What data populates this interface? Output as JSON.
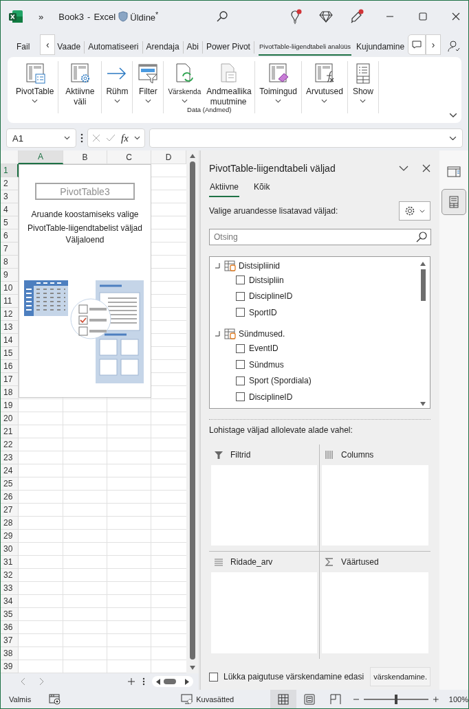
{
  "title_bar": {
    "quick_access": "»",
    "document": "Book3",
    "separator": "-",
    "app": "Excel",
    "sensitivity": "Üldine$^{*}$"
  },
  "ribbon_tabs": [
    {
      "label": "Fail",
      "selected": false
    },
    {
      "label": "Vaade",
      "selected": false
    },
    {
      "label": "Automatiseeri",
      "selected": false
    },
    {
      "label": "Arendaja",
      "selected": false
    },
    {
      "label": "Abi",
      "selected": false
    },
    {
      "label": "Power Pivot",
      "selected": false
    },
    {
      "label": "PivotTable-liigendtabeli analüüs",
      "selected": true
    },
    {
      "label": "Kujundamine",
      "selected": false
    }
  ],
  "ribbon_scroll": {
    "left": "‹",
    "right": "›"
  },
  "ribbon": {
    "groups": [
      {
        "commands": [
          {
            "kind": "pivottable",
            "label": "PivotTable",
            "dropdown": true
          }
        ]
      },
      {
        "commands": [
          {
            "kind": "active_field",
            "label": "Aktiivne väli",
            "dropdown": false
          }
        ]
      },
      {
        "commands": [
          {
            "kind": "group",
            "label": "Rühm",
            "dropdown": true
          }
        ]
      },
      {
        "commands": [
          {
            "kind": "filter",
            "label": "Filter",
            "dropdown": true
          }
        ]
      },
      {
        "label": "Data (Andmed)",
        "commands": [
          {
            "kind": "refresh",
            "label": "Värskenda",
            "dropdown": true
          },
          {
            "kind": "data_source",
            "label": "Andmeallika muutmine",
            "dropdown": false
          }
        ]
      },
      {
        "commands": [
          {
            "kind": "actions",
            "label": "Toimingud",
            "dropdown": true
          }
        ]
      },
      {
        "commands": [
          {
            "kind": "calculations",
            "label": "Arvutused",
            "dropdown": true
          }
        ]
      },
      {
        "commands": [
          {
            "kind": "show",
            "label": "Show",
            "dropdown": true
          }
        ]
      }
    ]
  },
  "formula_bar": {
    "name_box": "A1",
    "function_label": "fx"
  },
  "sheet": {
    "columns": [
      {
        "label": "A",
        "selected": true
      },
      {
        "label": "B",
        "selected": false
      },
      {
        "label": "C",
        "selected": false
      },
      {
        "label": "D",
        "selected": false
      }
    ],
    "rows": [
      {
        "label": "1",
        "selected": true
      },
      {
        "label": "2",
        "selected": false
      },
      {
        "label": "3",
        "selected": false
      },
      {
        "label": "4",
        "selected": false
      },
      {
        "label": "5",
        "selected": false
      },
      {
        "label": "6",
        "selected": false
      },
      {
        "label": "7",
        "selected": false
      },
      {
        "label": "8",
        "selected": false
      },
      {
        "label": "9",
        "selected": false
      },
      {
        "label": "10",
        "selected": false
      },
      {
        "label": "11",
        "selected": false
      },
      {
        "label": "12",
        "selected": false
      },
      {
        "label": "13",
        "selected": false
      },
      {
        "label": "14",
        "selected": false
      },
      {
        "label": "15",
        "selected": false
      },
      {
        "label": "16",
        "selected": false
      },
      {
        "label": "17",
        "selected": false
      },
      {
        "label": "18",
        "selected": false
      },
      {
        "label": "19",
        "selected": false
      },
      {
        "label": "20",
        "selected": false
      },
      {
        "label": "21",
        "selected": false
      },
      {
        "label": "22",
        "selected": false
      },
      {
        "label": "23",
        "selected": false
      },
      {
        "label": "24",
        "selected": false
      },
      {
        "label": "25",
        "selected": false
      },
      {
        "label": "26",
        "selected": false
      },
      {
        "label": "27",
        "selected": false
      },
      {
        "label": "28",
        "selected": false
      },
      {
        "label": "29",
        "selected": false
      },
      {
        "label": "30",
        "selected": false
      },
      {
        "label": "31",
        "selected": false
      },
      {
        "label": "32",
        "selected": false
      },
      {
        "label": "33",
        "selected": false
      },
      {
        "label": "34",
        "selected": false
      },
      {
        "label": "35",
        "selected": false
      },
      {
        "label": "36",
        "selected": false
      },
      {
        "label": "37",
        "selected": false
      },
      {
        "label": "38",
        "selected": false
      },
      {
        "label": "39",
        "selected": false
      }
    ],
    "pivot_placeholder": {
      "name": "PivotTable3",
      "instructions": "Aruande koostamiseks valige PivotTable-liigendtabelist väljad",
      "field_list": "Väljaloend"
    }
  },
  "pivot_pane": {
    "title": "PivotTable-liigendtabeli väljad",
    "tabs": [
      {
        "label": "Aktiivne",
        "selected": true
      },
      {
        "label": "Kõik",
        "selected": false
      }
    ],
    "choose_label": "Valige aruandesse lisatavad väljad:",
    "search": {
      "placeholder": "Otsing"
    },
    "tables": [
      {
        "name": "Distsipliinid",
        "expanded": true,
        "fields": [
          {
            "name": "Distsipliin",
            "checked": false
          },
          {
            "name": "DisciplineID",
            "checked": false
          },
          {
            "name": "SportID",
            "checked": false
          }
        ]
      },
      {
        "name": "Sündmused.",
        "expanded": true,
        "fields": [
          {
            "name": "EventID",
            "checked": false
          },
          {
            "name": "Sündmus",
            "checked": false
          },
          {
            "name": "Sport (Spordiala)",
            "checked": false
          },
          {
            "name": "DisciplineID",
            "checked": false
          }
        ]
      }
    ],
    "drag_label": "Lohistage väljad allolevate alade vahel:",
    "areas": [
      {
        "kind": "filters",
        "label": "Filtrid"
      },
      {
        "kind": "columns",
        "label": "Columns"
      },
      {
        "kind": "rows",
        "label": "Ridade_arv"
      },
      {
        "kind": "values",
        "label": "Väärtused"
      }
    ],
    "defer": {
      "label": "Lükka paigutuse värskendamine edasi",
      "checked": false
    },
    "update_button": "värskendamine."
  },
  "side_tabs": [
    {
      "kind": "pane",
      "selected": false
    },
    {
      "kind": "field_list",
      "selected": true
    }
  ],
  "status_bar": {
    "status": "Valmis",
    "display_settings": "Kuvasätted",
    "views": [
      {
        "kind": "normal",
        "selected": true
      },
      {
        "kind": "page_layout",
        "selected": false
      },
      {
        "kind": "page_break",
        "selected": false
      }
    ],
    "zoom": {
      "level": 0.5,
      "reading": "100%"
    }
  }
}
